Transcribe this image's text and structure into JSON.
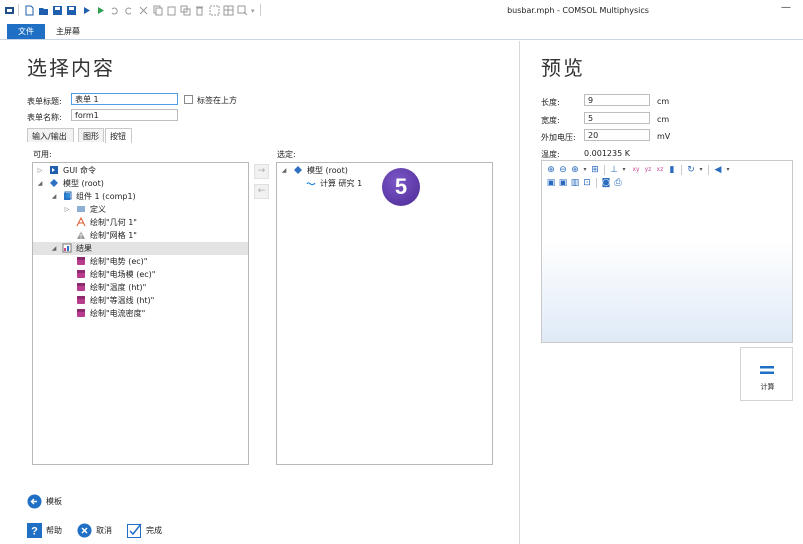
{
  "window": {
    "title": "busbar.mph - COMSOL Multiphysics",
    "minimize_glyph": "—"
  },
  "ribbon": {
    "tabs": [
      {
        "label": "文件"
      },
      {
        "label": "主屏幕"
      }
    ]
  },
  "left": {
    "heading": "选择内容",
    "form_title_label": "表单标题:",
    "form_title_value": "表单 1",
    "tabs_on_top_label": "标签在上方",
    "form_name_label": "表单名称:",
    "form_name_value": "form1",
    "tabs": [
      {
        "label": "输入/输出"
      },
      {
        "label": "图形"
      },
      {
        "label": "按钮"
      }
    ],
    "available_label": "可用:",
    "selected_label": "选定:",
    "available_tree": [
      {
        "label": "GUI 命令",
        "icon": "gui-commands-icon"
      },
      {
        "label": "模型 (root)",
        "icon": "model-root-icon"
      },
      {
        "label": "组件 1 (comp1)",
        "icon": "component-icon"
      },
      {
        "label": "定义",
        "icon": "definitions-icon"
      },
      {
        "label": "绘制\"几何 1\"",
        "icon": "geometry-icon"
      },
      {
        "label": "绘制\"网格 1\"",
        "icon": "mesh-icon"
      },
      {
        "label": "结果",
        "icon": "results-icon"
      },
      {
        "label": "绘制\"电势 (ec)\"",
        "icon": "plot-group-icon"
      },
      {
        "label": "绘制\"电场模 (ec)\"",
        "icon": "plot-group-icon"
      },
      {
        "label": "绘制\"温度 (ht)\"",
        "icon": "plot-group-icon"
      },
      {
        "label": "绘制\"等温线 (ht)\"",
        "icon": "plot-group-icon"
      },
      {
        "label": "绘制\"电流密度\"",
        "icon": "plot-group-icon"
      }
    ],
    "selected_tree": [
      {
        "label": "模型 (root)",
        "icon": "model-root-icon"
      },
      {
        "label": "计算 研究 1",
        "icon": "compute-study-icon"
      }
    ],
    "move_right_glyph": "→",
    "move_left_glyph": "←",
    "step_badge": "5",
    "template_button": "模板",
    "help_button": "帮助",
    "cancel_button": "取消",
    "done_button": "完成"
  },
  "right": {
    "heading": "预览",
    "params": [
      {
        "label": "长度:",
        "value": "9",
        "unit": "cm"
      },
      {
        "label": "宽度:",
        "value": "5",
        "unit": "cm"
      },
      {
        "label": "外加电压:",
        "value": "20",
        "unit": "mV"
      }
    ],
    "temperature_label": "温度:",
    "temperature_value": "0.001235 K",
    "compute_button": "计算"
  },
  "colors": {
    "accent": "#1f6fc5",
    "badge": "#5b37a8",
    "selected_row": "#e3e3e3"
  }
}
